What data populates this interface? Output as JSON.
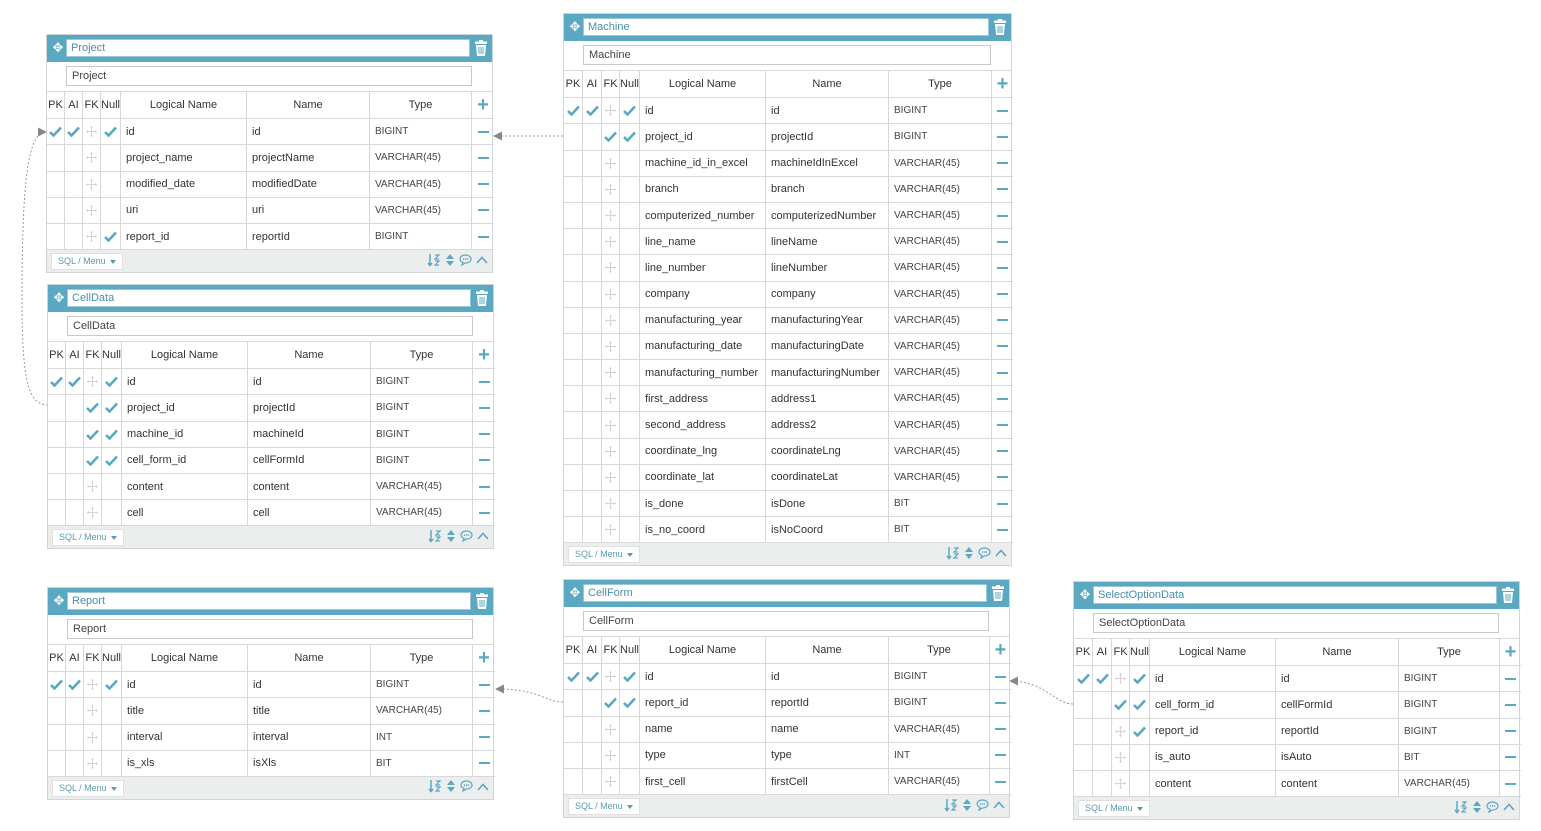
{
  "tables": [
    {
      "title": "Project",
      "name": "Project",
      "columns": [
        {
          "pk": true,
          "ai": true,
          "fk": false,
          "nul": true,
          "logical": "id",
          "name": "id",
          "type": "BIGINT"
        },
        {
          "pk": false,
          "ai": false,
          "fk": false,
          "nul": false,
          "logical": "project_name",
          "name": "projectName",
          "type": "VARCHAR(45)"
        },
        {
          "pk": false,
          "ai": false,
          "fk": false,
          "nul": false,
          "logical": "modified_date",
          "name": "modifiedDate",
          "type": "VARCHAR(45)"
        },
        {
          "pk": false,
          "ai": false,
          "fk": false,
          "nul": false,
          "logical": "uri",
          "name": "uri",
          "type": "VARCHAR(45)"
        },
        {
          "pk": false,
          "ai": false,
          "fk": false,
          "nul": true,
          "logical": "report_id",
          "name": "reportId",
          "type": "BIGINT"
        }
      ]
    },
    {
      "title": "CellData",
      "name": "CellData",
      "columns": [
        {
          "pk": true,
          "ai": true,
          "fk": false,
          "nul": true,
          "logical": "id",
          "name": "id",
          "type": "BIGINT"
        },
        {
          "pk": false,
          "ai": false,
          "fk": true,
          "nul": true,
          "logical": "project_id",
          "name": "projectId",
          "type": "BIGINT"
        },
        {
          "pk": false,
          "ai": false,
          "fk": true,
          "nul": true,
          "logical": "machine_id",
          "name": "machineId",
          "type": "BIGINT"
        },
        {
          "pk": false,
          "ai": false,
          "fk": true,
          "nul": true,
          "logical": "cell_form_id",
          "name": "cellFormId",
          "type": "BIGINT"
        },
        {
          "pk": false,
          "ai": false,
          "fk": false,
          "nul": false,
          "logical": "content",
          "name": "content",
          "type": "VARCHAR(45)"
        },
        {
          "pk": false,
          "ai": false,
          "fk": false,
          "nul": false,
          "logical": "cell",
          "name": "cell",
          "type": "VARCHAR(45)"
        }
      ]
    },
    {
      "title": "Report",
      "name": "Report",
      "columns": [
        {
          "pk": true,
          "ai": true,
          "fk": false,
          "nul": true,
          "logical": "id",
          "name": "id",
          "type": "BIGINT"
        },
        {
          "pk": false,
          "ai": false,
          "fk": false,
          "nul": false,
          "logical": "title",
          "name": "title",
          "type": "VARCHAR(45)"
        },
        {
          "pk": false,
          "ai": false,
          "fk": false,
          "nul": false,
          "logical": "interval",
          "name": "interval",
          "type": "INT"
        },
        {
          "pk": false,
          "ai": false,
          "fk": false,
          "nul": false,
          "logical": "is_xls",
          "name": "isXls",
          "type": "BIT"
        }
      ]
    },
    {
      "title": "Machine",
      "name": "Machine",
      "columns": [
        {
          "pk": true,
          "ai": true,
          "fk": false,
          "nul": true,
          "logical": "id",
          "name": "id",
          "type": "BIGINT"
        },
        {
          "pk": false,
          "ai": false,
          "fk": true,
          "nul": true,
          "logical": "project_id",
          "name": "projectId",
          "type": "BIGINT"
        },
        {
          "pk": false,
          "ai": false,
          "fk": false,
          "nul": false,
          "logical": "machine_id_in_excel",
          "name": "machineIdInExcel",
          "type": "VARCHAR(45)"
        },
        {
          "pk": false,
          "ai": false,
          "fk": false,
          "nul": false,
          "logical": "branch",
          "name": "branch",
          "type": "VARCHAR(45)"
        },
        {
          "pk": false,
          "ai": false,
          "fk": false,
          "nul": false,
          "logical": "computerized_number",
          "name": "computerizedNumber",
          "type": "VARCHAR(45)"
        },
        {
          "pk": false,
          "ai": false,
          "fk": false,
          "nul": false,
          "logical": "line_name",
          "name": "lineName",
          "type": "VARCHAR(45)"
        },
        {
          "pk": false,
          "ai": false,
          "fk": false,
          "nul": false,
          "logical": "line_number",
          "name": "lineNumber",
          "type": "VARCHAR(45)"
        },
        {
          "pk": false,
          "ai": false,
          "fk": false,
          "nul": false,
          "logical": "company",
          "name": "company",
          "type": "VARCHAR(45)"
        },
        {
          "pk": false,
          "ai": false,
          "fk": false,
          "nul": false,
          "logical": "manufacturing_year",
          "name": "manufacturingYear",
          "type": "VARCHAR(45)"
        },
        {
          "pk": false,
          "ai": false,
          "fk": false,
          "nul": false,
          "logical": "manufacturing_date",
          "name": "manufacturingDate",
          "type": "VARCHAR(45)"
        },
        {
          "pk": false,
          "ai": false,
          "fk": false,
          "nul": false,
          "logical": "manufacturing_number",
          "name": "manufacturingNumber",
          "type": "VARCHAR(45)"
        },
        {
          "pk": false,
          "ai": false,
          "fk": false,
          "nul": false,
          "logical": "first_address",
          "name": "address1",
          "type": "VARCHAR(45)"
        },
        {
          "pk": false,
          "ai": false,
          "fk": false,
          "nul": false,
          "logical": "second_address",
          "name": "address2",
          "type": "VARCHAR(45)"
        },
        {
          "pk": false,
          "ai": false,
          "fk": false,
          "nul": false,
          "logical": "coordinate_lng",
          "name": "coordinateLng",
          "type": "VARCHAR(45)"
        },
        {
          "pk": false,
          "ai": false,
          "fk": false,
          "nul": false,
          "logical": "coordinate_lat",
          "name": "coordinateLat",
          "type": "VARCHAR(45)"
        },
        {
          "pk": false,
          "ai": false,
          "fk": false,
          "nul": false,
          "logical": "is_done",
          "name": "isDone",
          "type": "BIT"
        },
        {
          "pk": false,
          "ai": false,
          "fk": false,
          "nul": false,
          "logical": "is_no_coord",
          "name": "isNoCoord",
          "type": "BIT"
        }
      ]
    },
    {
      "title": "CellForm",
      "name": "CellForm",
      "columns": [
        {
          "pk": true,
          "ai": true,
          "fk": false,
          "nul": true,
          "logical": "id",
          "name": "id",
          "type": "BIGINT"
        },
        {
          "pk": false,
          "ai": false,
          "fk": true,
          "nul": true,
          "logical": "report_id",
          "name": "reportId",
          "type": "BIGINT"
        },
        {
          "pk": false,
          "ai": false,
          "fk": false,
          "nul": false,
          "logical": "name",
          "name": "name",
          "type": "VARCHAR(45)"
        },
        {
          "pk": false,
          "ai": false,
          "fk": false,
          "nul": false,
          "logical": "type",
          "name": "type",
          "type": "INT"
        },
        {
          "pk": false,
          "ai": false,
          "fk": false,
          "nul": false,
          "logical": "first_cell",
          "name": "firstCell",
          "type": "VARCHAR(45)"
        }
      ]
    },
    {
      "title": "SelectOptionData",
      "name": "SelectOptionData",
      "columns": [
        {
          "pk": true,
          "ai": true,
          "fk": false,
          "nul": true,
          "logical": "id",
          "name": "id",
          "type": "BIGINT"
        },
        {
          "pk": false,
          "ai": false,
          "fk": true,
          "nul": true,
          "logical": "cell_form_id",
          "name": "cellFormId",
          "type": "BIGINT"
        },
        {
          "pk": false,
          "ai": false,
          "fk": false,
          "nul": true,
          "logical": "report_id",
          "name": "reportId",
          "type": "BIGINT"
        },
        {
          "pk": false,
          "ai": false,
          "fk": false,
          "nul": false,
          "logical": "is_auto",
          "name": "isAuto",
          "type": "BIT"
        },
        {
          "pk": false,
          "ai": false,
          "fk": false,
          "nul": false,
          "logical": "content",
          "name": "content",
          "type": "VARCHAR(45)"
        }
      ]
    }
  ],
  "headers": {
    "pk": "PK",
    "ai": "AI",
    "fk": "FK",
    "nul": "Null",
    "logical": "Logical Name",
    "name": "Name",
    "type": "Type"
  },
  "footer": {
    "sql_menu": "SQL / Menu"
  },
  "colors": {
    "accent": "#5ba8c3",
    "link": "#888888"
  }
}
